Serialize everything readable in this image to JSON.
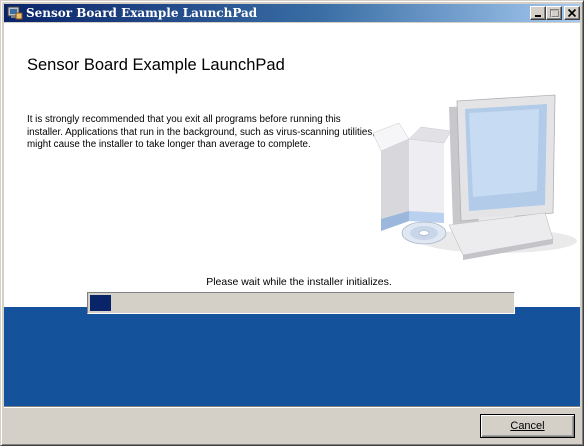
{
  "window": {
    "title": "Sensor Board Example LaunchPad",
    "title_icon": "installer-icon"
  },
  "title_buttons": {
    "minimize_icon": "minimize-icon",
    "maximize_icon": "maximize-icon",
    "close_icon": "close-icon",
    "maximize_enabled": false
  },
  "main": {
    "heading": "Sensor Board Example LaunchPad",
    "intro": "It is strongly recommended that you exit all programs before running this installer. Applications that run in the background, such as virus-scanning utilities, might cause the installer to take longer than average to complete.",
    "illustration_icon": "computer-with-box-and-cd-icon",
    "status": "Please wait while the installer initializes."
  },
  "progress": {
    "value_fraction": 0.05,
    "fill_color": "#0a246a"
  },
  "footer": {
    "cancel_label": "Cancel"
  },
  "colors": {
    "title_bar_start": "#0a246a",
    "title_bar_end": "#a6caf0",
    "band": "#14539b",
    "chrome": "#d4d0c8"
  }
}
